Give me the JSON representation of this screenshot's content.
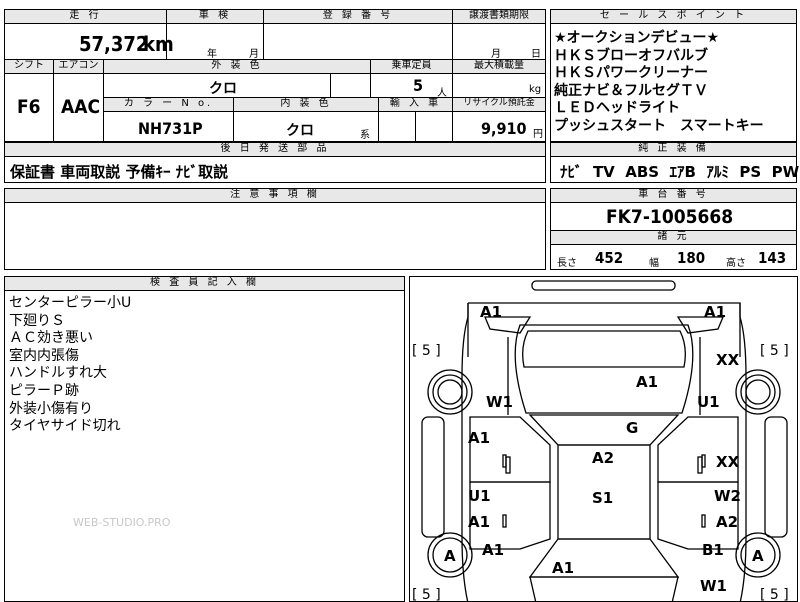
{
  "header": {
    "mileage_label": "走 行",
    "mileage_value": "57,372",
    "mileage_unit": "km",
    "inspection_label": "車 検",
    "year_label": "年",
    "month_label": "月",
    "reg_label": "登 録 番 号",
    "transfer_label": "譲渡書類期限",
    "transfer_month": "月",
    "transfer_day": "日",
    "shift_label": "シフト",
    "shift_value": "F6",
    "ac_label": "エアコン",
    "ac_value": "AAC",
    "exterior_label": "外 装 色",
    "exterior_value": "クロ",
    "capacity_label": "乗車定員",
    "capacity_value": "5",
    "capacity_unit": "人",
    "load_label": "最大積載量",
    "load_unit": "kg",
    "color_no_label": "カ ラ ー N o.",
    "color_no_value": "NH731P",
    "interior_label": "内 装 色",
    "interior_value": "クロ",
    "interior_unit": "系",
    "import_label": "輸 入 車",
    "recycle_label": "リサイクル預託金",
    "recycle_value": "9,910",
    "recycle_unit": "円"
  },
  "sales_points": {
    "label": "セ ー ル ス ポ イ ン ト",
    "items": [
      "★オークションデビュー★",
      "ＨＫＳブローオフバルブ",
      "ＨＫＳパワークリーナー",
      "純正ナビ＆フルセグＴＶ",
      "ＬＥＤヘッドライト",
      "プッシュスタート　スマートキー"
    ]
  },
  "accessories": {
    "label": "後 日 発 送 部 品",
    "value": "保証書 車両取説 予備ｷｰ ﾅﾋﾞ取説"
  },
  "equipment": {
    "label": "純 正 装 備",
    "value": "ﾅﾋﾞ  TV  ABS  ｴｱB  ｱﾙﾐ  PS  PW"
  },
  "caution": {
    "label": "注 意 事 項 欄"
  },
  "chassis": {
    "label": "車 台 番 号",
    "value": "FK7-1005668"
  },
  "dimensions": {
    "label": "諸 元",
    "length_label": "長さ",
    "length": "452",
    "width_label": "幅",
    "width": "180",
    "height_label": "高さ",
    "height": "143"
  },
  "inspector": {
    "label": "検 査 員 記 入 欄",
    "notes": [
      "センターピラー小U",
      "下廻りＳ",
      "ＡＣ効き悪い",
      "室内内張傷",
      "ハンドルすれ大",
      "ピラーＰ跡",
      "外装小傷有り",
      "タイヤサイド切れ"
    ]
  },
  "watermark": "WEB-STUDIO.PRO",
  "diagram": {
    "tires": [
      "[ 5 ]",
      "[ 5 ]",
      "[ 5 ]",
      "[ 5 ]"
    ],
    "marks": {
      "front_left": "A1",
      "front_right": "A1",
      "fender_right_top": "XX",
      "hood": "A1",
      "windshield_left": "W1",
      "pillar_right": "U1",
      "door_fl": "A1",
      "roof": "G",
      "door_fr": "XX",
      "center": "A2",
      "door_rl_u": "U1",
      "door_rl_a": "A1",
      "seat": "S1",
      "door_rr_w": "W2",
      "door_rr_a": "A2",
      "wheel_rl": "A",
      "rear_left": "A1",
      "rear_right": "B1",
      "wheel_rr": "A",
      "trunk": "A1",
      "rear_glass": "W1"
    }
  }
}
